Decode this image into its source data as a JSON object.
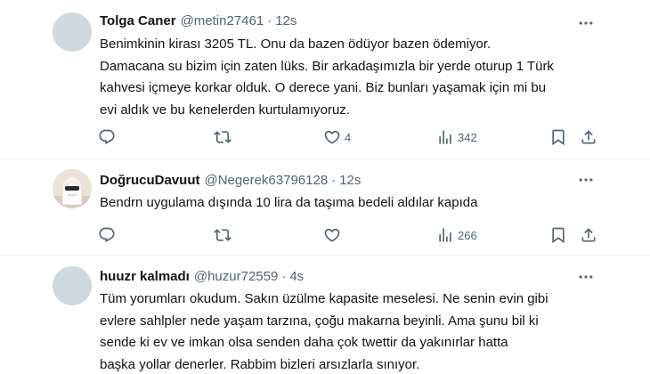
{
  "tweets": [
    {
      "name": "Tolga Caner",
      "handle": "@metin27461",
      "time": "12s",
      "text": "Benimkinin kirası 3205 TL. Onu da bazen ödüyor bazen ödemiyor.\nDamacana su bizim için zaten lüks. Bir arkadaşımızla bir yerde oturup 1 Türk\nkahvesi içmeye korkar olduk. O derece yani. Biz bunları yaşamak için mi bu\nevi aldık ve bu kenelerden kurtulamıyoruz.",
      "likes": "4",
      "views": "342",
      "avatar": "default"
    },
    {
      "name": "DoğrucuDavuut",
      "handle": "@Negerek63796128",
      "time": "12s",
      "text": "Bendrn uygulama dışında 10 lira da taşıma bedeli aldılar kapıda",
      "likes": "",
      "views": "266",
      "avatar": "photo"
    },
    {
      "name": "huuzr kalmadı",
      "handle": "@huzur72559",
      "time": "4s",
      "text": "Tüm yorumları okudum. Sakın üzülme  kapasite meselesi. Ne senin evin gibi\nevlere sahlpler nede yaşam tarzına, çoğu makarna beyinli. Ama şunu bil ki\nsende ki ev ve imkan olsa senden daha çok twettir da yakınırlar  hatta\nbaşka yollar denerler. Rabbim bizleri arsızlarla  sınıyor.",
      "avatar": "default"
    }
  ],
  "separator": "·",
  "icons": {
    "more": "more-horizontal-icon",
    "reply": "reply-icon",
    "retweet": "retweet-icon",
    "like": "heart-icon",
    "views": "views-chart-icon",
    "bookmark": "bookmark-icon",
    "share": "share-icon"
  },
  "colors": {
    "text": "#0f1419",
    "secondary": "#536471",
    "divider": "#eff3f4",
    "avatar_default": "#cfd9de"
  }
}
